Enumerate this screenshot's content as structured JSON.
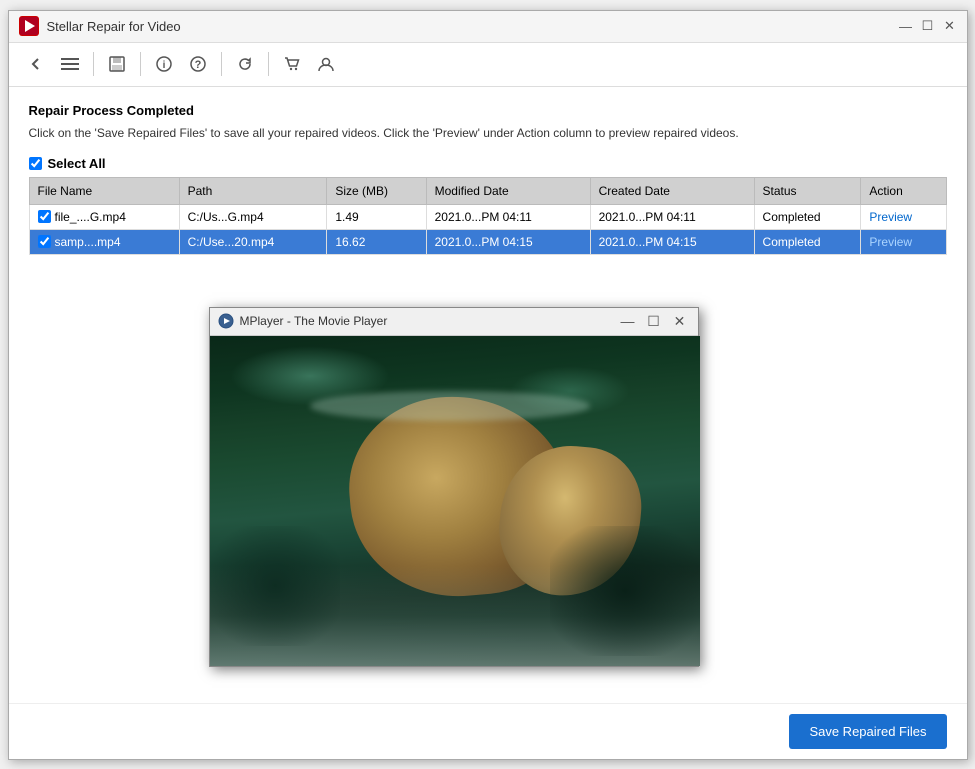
{
  "window": {
    "title": "Stellar Repair for Video",
    "app_icon": "▶",
    "controls": {
      "minimize": "—",
      "maximize": "✕",
      "close": "✕"
    }
  },
  "toolbar": {
    "back_icon": "←",
    "menu_icon": "≡",
    "save_icon": "💾",
    "info_icon": "ⓘ",
    "help_icon": "?",
    "refresh_icon": "↻",
    "cart_icon": "🛒",
    "account_icon": "⊙"
  },
  "status": {
    "title": "Repair Process Completed",
    "description": "Click on the 'Save Repaired Files' to save all your repaired videos. Click the 'Preview' under Action column to preview repaired videos."
  },
  "select_all": {
    "label": "Select All",
    "checked": true
  },
  "table": {
    "headers": [
      "File Name",
      "Path",
      "Size (MB)",
      "Modified Date",
      "Created Date",
      "Status",
      "Action"
    ],
    "rows": [
      {
        "checked": true,
        "filename": "file_....G.mp4",
        "path": "C:/Us...G.mp4",
        "size": "1.49",
        "modified": "2021.0...PM 04:11",
        "created": "2021.0...PM 04:11",
        "status": "Completed",
        "action": "Preview",
        "selected": false
      },
      {
        "checked": true,
        "filename": "samp....mp4",
        "path": "C:/Use...20.mp4",
        "size": "16.62",
        "modified": "2021.0...PM 04:15",
        "created": "2021.0...PM 04:15",
        "status": "Completed",
        "action": "Preview",
        "selected": true
      }
    ]
  },
  "mplayer": {
    "title": "MPlayer - The Movie Player",
    "icon": "🎬",
    "controls": {
      "minimize": "—",
      "maximize": "☐",
      "close": "✕"
    }
  },
  "save_button": {
    "label": "Save Repaired Files"
  }
}
